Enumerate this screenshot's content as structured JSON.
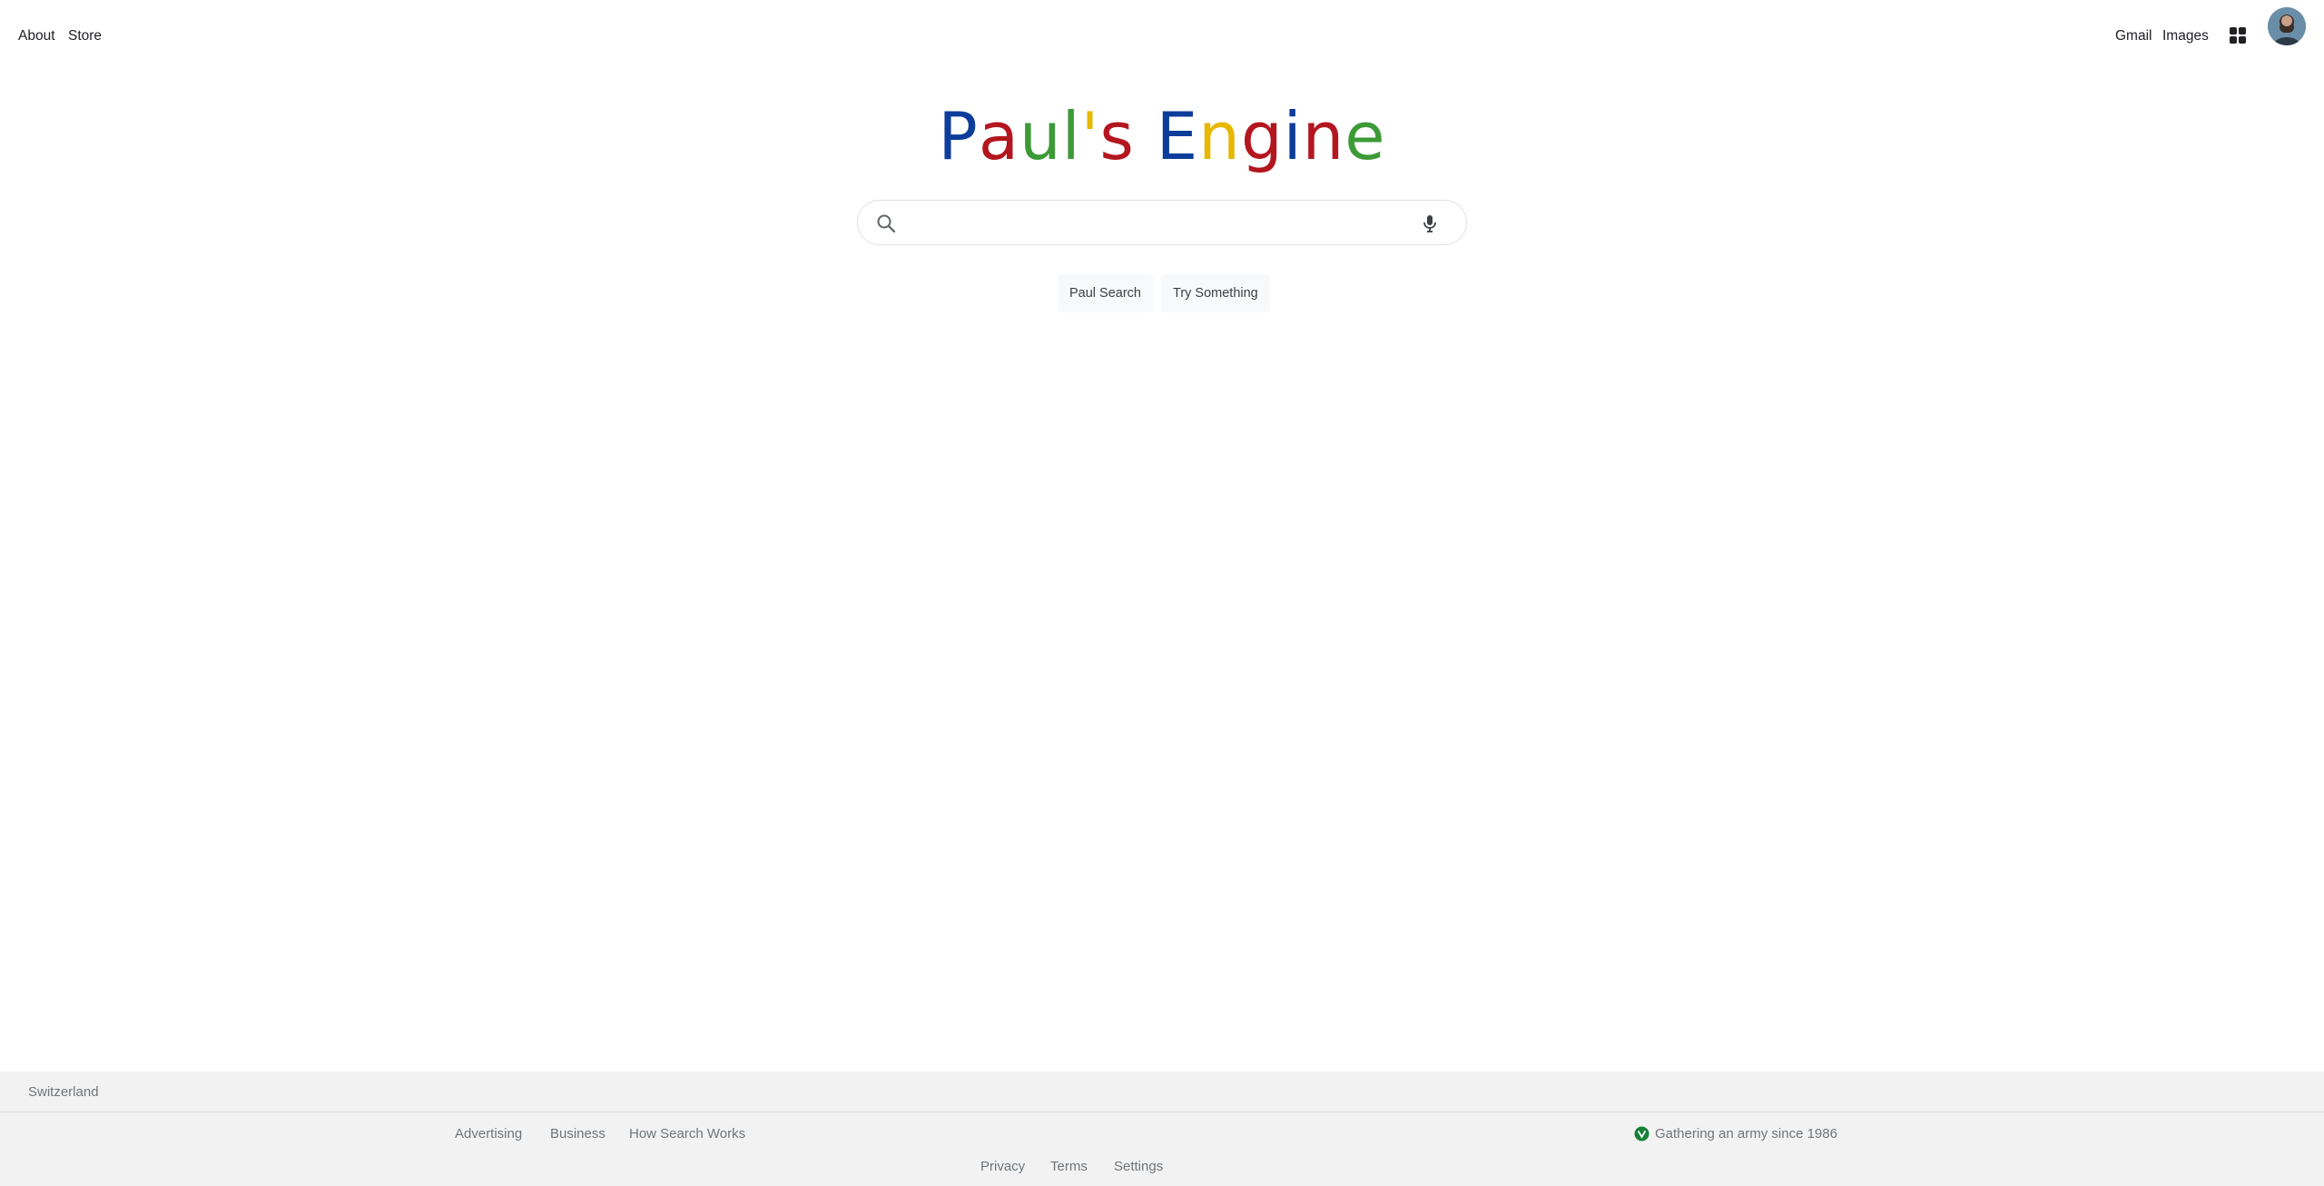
{
  "header": {
    "left_links": [
      "About",
      "Store"
    ],
    "right_links": [
      "Gmail",
      "Images"
    ],
    "apps_icon": "apps-grid-icon",
    "avatar_icon": "user-avatar"
  },
  "logo": {
    "letters": [
      {
        "ch": "P",
        "color": "#0d3d9a"
      },
      {
        "ch": "a",
        "color": "#b3161e"
      },
      {
        "ch": "u",
        "color": "#3c9a37"
      },
      {
        "ch": "l",
        "color": "#3c9a37"
      },
      {
        "ch": "'",
        "color": "#e6b800"
      },
      {
        "ch": "s",
        "color": "#b3161e"
      },
      {
        "ch": " ",
        "color": "#000000"
      },
      {
        "ch": "E",
        "color": "#0d3d9a"
      },
      {
        "ch": "n",
        "color": "#e6b800"
      },
      {
        "ch": "g",
        "color": "#b3161e"
      },
      {
        "ch": "i",
        "color": "#0d3d9a"
      },
      {
        "ch": "n",
        "color": "#b3161e"
      },
      {
        "ch": "e",
        "color": "#3c9a37"
      }
    ]
  },
  "search": {
    "value": "",
    "placeholder": "",
    "search_icon": "search-icon",
    "mic_icon": "microphone-icon"
  },
  "buttons": {
    "search": "Paul Search",
    "lucky": "Try Something"
  },
  "footer": {
    "country": "Switzerland",
    "left_links": [
      "Advertising",
      "Business",
      "How Search Works"
    ],
    "carbon_text": "Gathering an army since 1986",
    "bottom_links": [
      "Privacy",
      "Terms",
      "Settings"
    ]
  },
  "colors": {
    "footer_bg": "#f2f2f2",
    "footer_text": "#70757a",
    "leaf_green": "#188038"
  }
}
